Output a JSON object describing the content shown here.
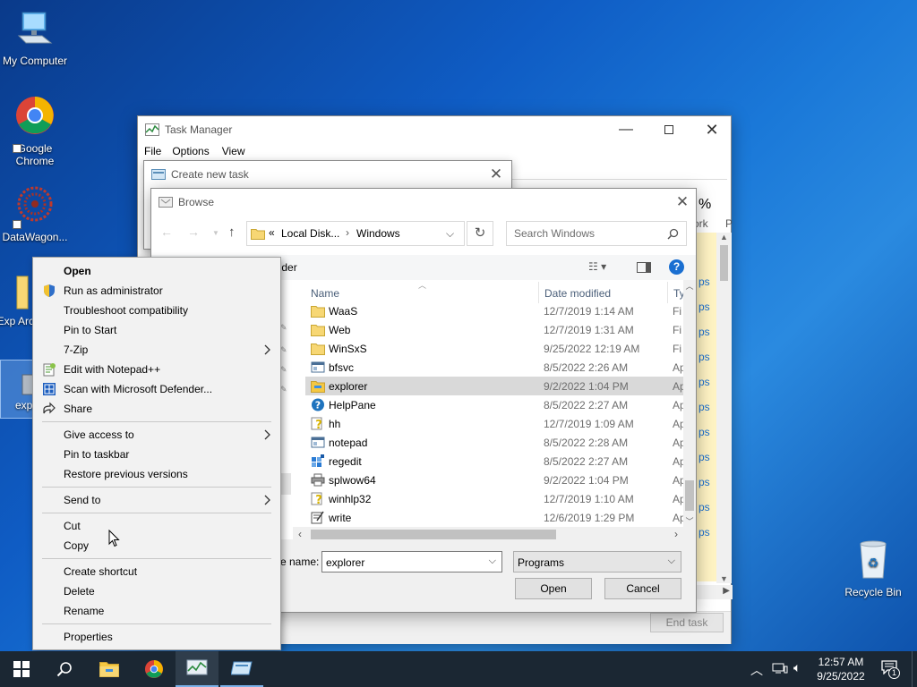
{
  "desktop": {
    "icons": [
      {
        "label": "My Computer"
      },
      {
        "label": "Google Chrome"
      },
      {
        "label": "DataWagon..."
      },
      {
        "label": "Exp Arc"
      },
      {
        "label": "expl"
      },
      {
        "label": "Recycle Bin"
      }
    ]
  },
  "task_manager": {
    "title": "Task Manager",
    "menu": [
      "File",
      "Options",
      "View"
    ],
    "end_task": "End task",
    "partial_header": "%",
    "partial_col": "ork",
    "partial_col2": "P",
    "partial_rows": [
      "ps",
      "ps",
      "ps",
      "ps",
      "ps",
      "ps",
      "ps",
      "ps",
      "ps",
      "ps",
      "ps"
    ]
  },
  "create_task": {
    "title": "Create new task"
  },
  "browse": {
    "title": "Browse",
    "path": [
      "Local Disk...",
      "Windows"
    ],
    "path_prefix": "«",
    "search_placeholder": "Search Windows",
    "new_folder": "older",
    "columns": {
      "name": "Name",
      "date": "Date modified",
      "type": "Ty"
    },
    "files": [
      {
        "name": "WaaS",
        "date": "12/7/2019 1:14 AM",
        "type": "Fi",
        "icon": "folder-icon"
      },
      {
        "name": "Web",
        "date": "12/7/2019 1:31 AM",
        "type": "Fi",
        "icon": "folder-icon"
      },
      {
        "name": "WinSxS",
        "date": "9/25/2022 12:19 AM",
        "type": "Fi",
        "icon": "folder-icon"
      },
      {
        "name": "bfsvc",
        "date": "8/5/2022 2:26 AM",
        "type": "Ap",
        "icon": "app-icon"
      },
      {
        "name": "explorer",
        "date": "9/2/2022 1:04 PM",
        "type": "Ap",
        "icon": "explorer-icon"
      },
      {
        "name": "HelpPane",
        "date": "8/5/2022 2:27 AM",
        "type": "Ap",
        "icon": "help-icon"
      },
      {
        "name": "hh",
        "date": "12/7/2019 1:09 AM",
        "type": "Ap",
        "icon": "hh-icon"
      },
      {
        "name": "notepad",
        "date": "8/5/2022 2:28 AM",
        "type": "Ap",
        "icon": "app-icon"
      },
      {
        "name": "regedit",
        "date": "8/5/2022 2:27 AM",
        "type": "Ap",
        "icon": "regedit-icon"
      },
      {
        "name": "splwow64",
        "date": "9/2/2022 1:04 PM",
        "type": "Ap",
        "icon": "printer-icon"
      },
      {
        "name": "winhlp32",
        "date": "12/7/2019 1:10 AM",
        "type": "Ap",
        "icon": "hh-icon"
      },
      {
        "name": "write",
        "date": "12/6/2019 1:29 PM",
        "type": "Ap",
        "icon": "write-icon"
      }
    ],
    "filename_label": "e name:",
    "filename_value": "explorer",
    "filetype_value": "Programs",
    "open_label": "Open",
    "cancel_label": "Cancel"
  },
  "context_menu": {
    "items": [
      {
        "label": "Open",
        "bold": true
      },
      {
        "label": "Run as administrator",
        "icon": "shield-icon"
      },
      {
        "label": "Troubleshoot compatibility"
      },
      {
        "label": "Pin to Start"
      },
      {
        "label": "7-Zip",
        "submenu": true
      },
      {
        "label": "Edit with Notepad++",
        "icon": "notepadpp-icon"
      },
      {
        "label": "Scan with Microsoft Defender...",
        "icon": "defender-icon"
      },
      {
        "label": "Share",
        "icon": "share-icon"
      },
      {
        "sep": true
      },
      {
        "label": "Give access to",
        "submenu": true
      },
      {
        "label": "Pin to taskbar"
      },
      {
        "label": "Restore previous versions"
      },
      {
        "sep": true
      },
      {
        "label": "Send to",
        "submenu": true
      },
      {
        "sep": true
      },
      {
        "label": "Cut"
      },
      {
        "label": "Copy"
      },
      {
        "sep": true
      },
      {
        "label": "Create shortcut"
      },
      {
        "label": "Delete"
      },
      {
        "label": "Rename"
      },
      {
        "sep": true
      },
      {
        "label": "Properties"
      }
    ]
  },
  "taskbar": {
    "time": "12:57 AM",
    "date": "9/25/2022",
    "notification_count": "1"
  }
}
